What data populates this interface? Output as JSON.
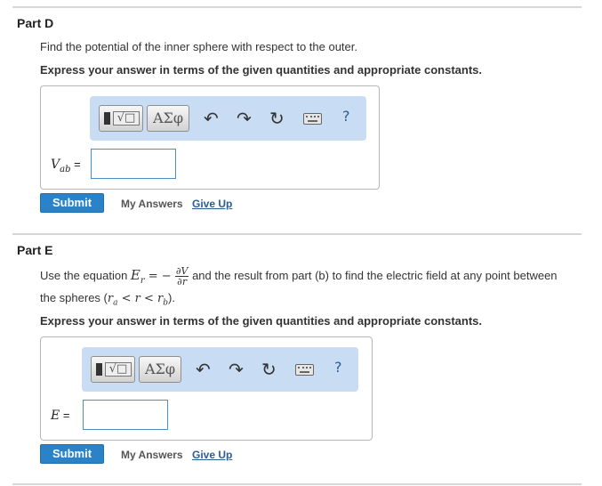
{
  "partD": {
    "title": "Part D",
    "prompt": "Find the potential of the inner sphere with respect to the outer.",
    "instruction": "Express your answer in terms of the given quantities and appropriate constants.",
    "var_main": "V",
    "var_sub": "ab",
    "var_eq": " =",
    "input_value": "",
    "submit_label": "Submit",
    "my_answers_label": "My Answers",
    "give_up_label": "Give Up"
  },
  "partE": {
    "title": "Part E",
    "prompt_before": "Use the equation ",
    "eq_lhs": "E",
    "eq_lhs_sub": "r",
    "eq_mid": " = − ",
    "eq_num": "∂V",
    "eq_den": "∂r",
    "prompt_after": " and the result from part (b) to find the electric field at any point between",
    "prompt_line2_before": "the spheres (",
    "range": "r",
    "range_a_sub": "a",
    "range_mid": " < r < ",
    "range_b": "r",
    "range_b_sub": "b",
    "prompt_line2_after": ").",
    "instruction": "Express your answer in terms of the given quantities and appropriate constants.",
    "var_main": "E",
    "var_eq": " =",
    "input_value": "",
    "submit_label": "Submit",
    "my_answers_label": "My Answers",
    "give_up_label": "Give Up"
  },
  "toolbar": {
    "templates_glyph": "√□",
    "greek_label": "ΑΣφ",
    "undo_glyph": "↶",
    "redo_glyph": "↷",
    "reset_glyph": "↻",
    "help_label": "?",
    "icons": [
      "templates-icon",
      "greek-icon",
      "undo-icon",
      "redo-icon",
      "reset-icon",
      "keyboard-icon",
      "help-icon"
    ]
  },
  "colors": {
    "toolbar_bg": "#c8dcf3",
    "submit_bg": "#2a83c9",
    "link": "#2b5d96",
    "input_border": "#4a90c8"
  }
}
